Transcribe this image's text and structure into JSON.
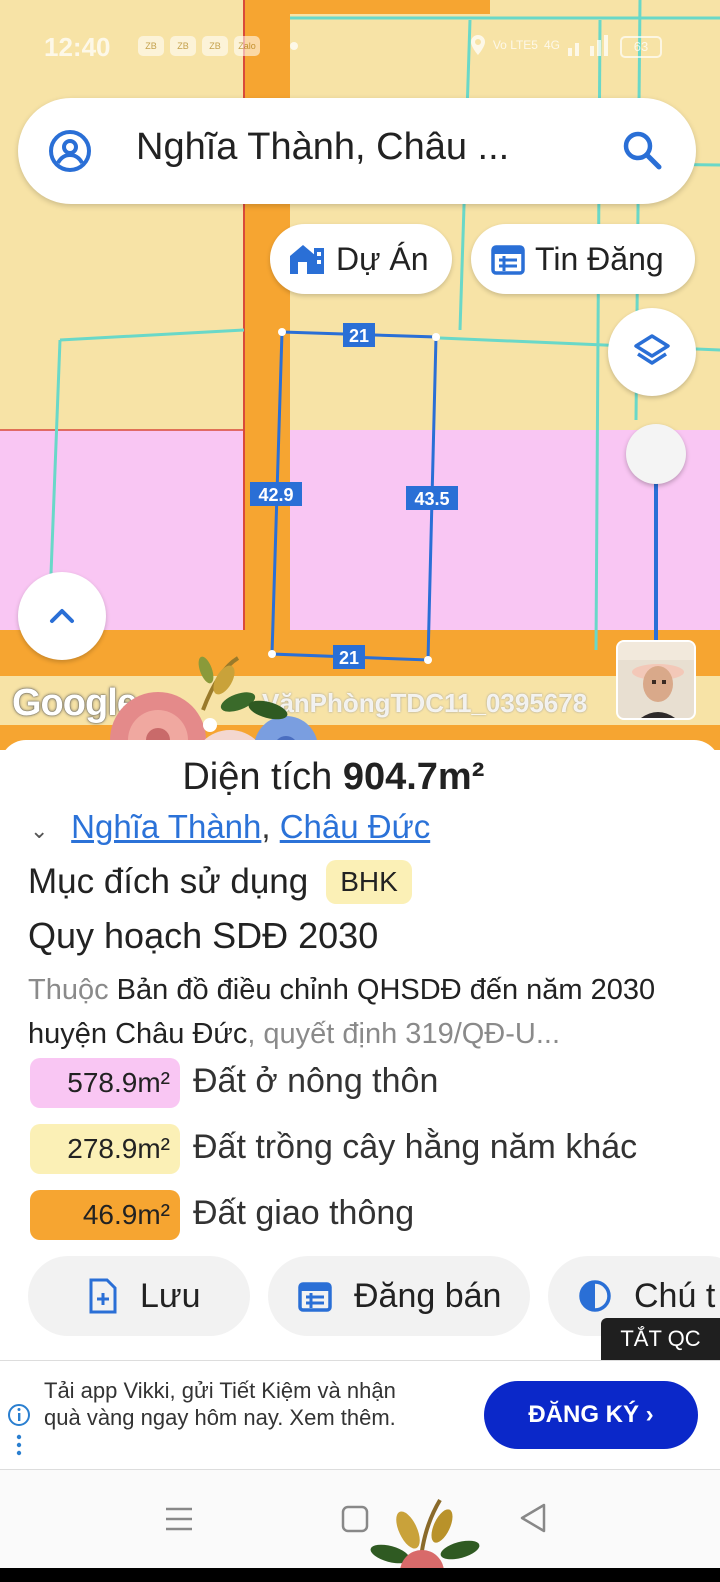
{
  "status_bar": {
    "time": "12:40",
    "apps": [
      "ZB",
      "ZB",
      "ZB",
      "Zalo"
    ],
    "network": "Vo LTE5",
    "signal": "4G",
    "battery": "63"
  },
  "search": {
    "text": "Nghĩa Thành, Châu ..."
  },
  "chips": {
    "projects": "Dự Án",
    "listings": "Tin Đăng"
  },
  "map": {
    "dimensions": {
      "top": "21",
      "bottom": "21",
      "left": "42.9",
      "right": "43.5"
    },
    "google_label": "Google",
    "watermark": "VănPhòngTDC11_0395678"
  },
  "parcel": {
    "area_prefix": "Diện tích",
    "area_value": "904.7m²",
    "location_links": [
      "Nghĩa Thành",
      "Châu Đức"
    ],
    "location_separator": ", ",
    "purpose_label": "Mục đích sử dụng",
    "purpose_code": "BHK",
    "plan_heading": "Quy hoạch SDĐ 2030",
    "plan_desc_prefix": "Thuộc",
    "plan_desc_main": "Bản đồ điều chỉnh QHSDĐ đến năm 2030 huyện Châu Đức",
    "plan_desc_suffix": ", quyết định 319/QĐ-U...",
    "land_use": [
      {
        "area": "578.9m²",
        "label": "Đất ở nông thôn",
        "color": "#f9c6f3"
      },
      {
        "area": "278.9m²",
        "label": "Đất trồng cây hằng năm khác",
        "color": "#fbf0b6"
      },
      {
        "area": "46.9m²",
        "label": "Đất giao thông",
        "color": "#f6a531"
      }
    ]
  },
  "actions": {
    "save": "Lưu",
    "post": "Đăng bán",
    "legend": "Chú t"
  },
  "ad": {
    "close_label": "TẮT QC",
    "text": "Tải app Vikki, gửi Tiết Kiệm và nhận quà vàng ngay hôm nay. Xem thêm.",
    "cta": "ĐĂNG KÝ ›"
  },
  "colors": {
    "accent": "#2a6fd6",
    "road": "#f6a531",
    "residential": "#f9c6f3",
    "farmland": "#f7e3a6",
    "ad_cta": "#0b28c9"
  }
}
